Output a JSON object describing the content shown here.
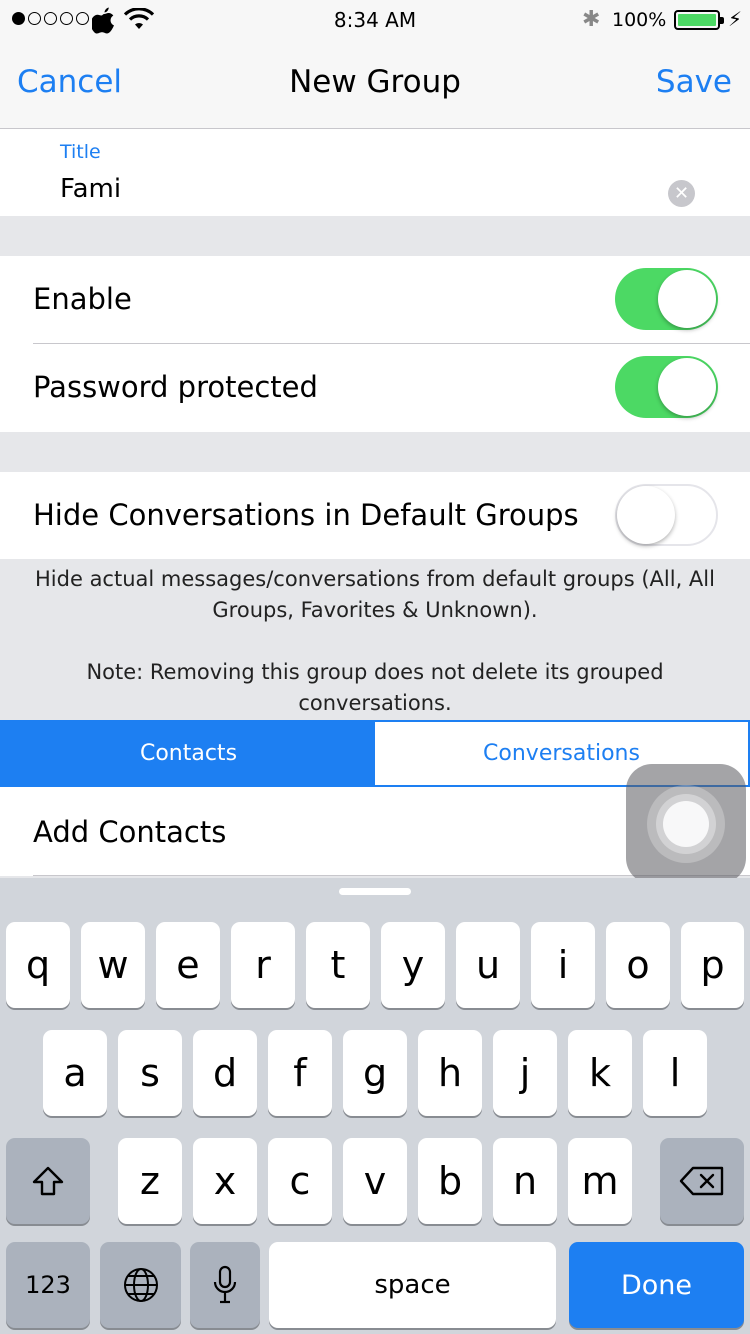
{
  "status_bar": {
    "time": "8:34 AM",
    "battery_percent": "100%",
    "signal_dots": [
      true,
      false,
      false,
      false,
      false
    ],
    "carrier_icon": "apple-icon",
    "battery_color": "#4cd964"
  },
  "nav": {
    "cancel_label": "Cancel",
    "title": "New Group",
    "save_label": "Save"
  },
  "title_field": {
    "label": "Title",
    "value": "Fami"
  },
  "settings": {
    "enable": {
      "label": "Enable",
      "on": true
    },
    "password": {
      "label": "Password protected",
      "on": true
    },
    "hide": {
      "label": "Hide Conversations in Default Groups",
      "on": false
    }
  },
  "footnote": {
    "line1": "Hide actual messages/conversations from default groups (All, All Groups, Favorites & Unknown).",
    "line2": "Note: Removing this group does not delete its grouped conversations."
  },
  "segments": {
    "contacts": "Contacts",
    "conversations": "Conversations",
    "selected": "Contacts"
  },
  "add_contacts_label": "Add Contacts",
  "keyboard": {
    "row1": [
      "q",
      "w",
      "e",
      "r",
      "t",
      "y",
      "u",
      "i",
      "o",
      "p"
    ],
    "row2": [
      "a",
      "s",
      "d",
      "f",
      "g",
      "h",
      "j",
      "k",
      "l"
    ],
    "row3": [
      "z",
      "x",
      "c",
      "v",
      "b",
      "n",
      "m"
    ],
    "numbers_label": "123",
    "space_label": "space",
    "done_label": "Done"
  },
  "colors": {
    "accent": "#1d7ff2",
    "toggle_on": "#4cd964"
  }
}
